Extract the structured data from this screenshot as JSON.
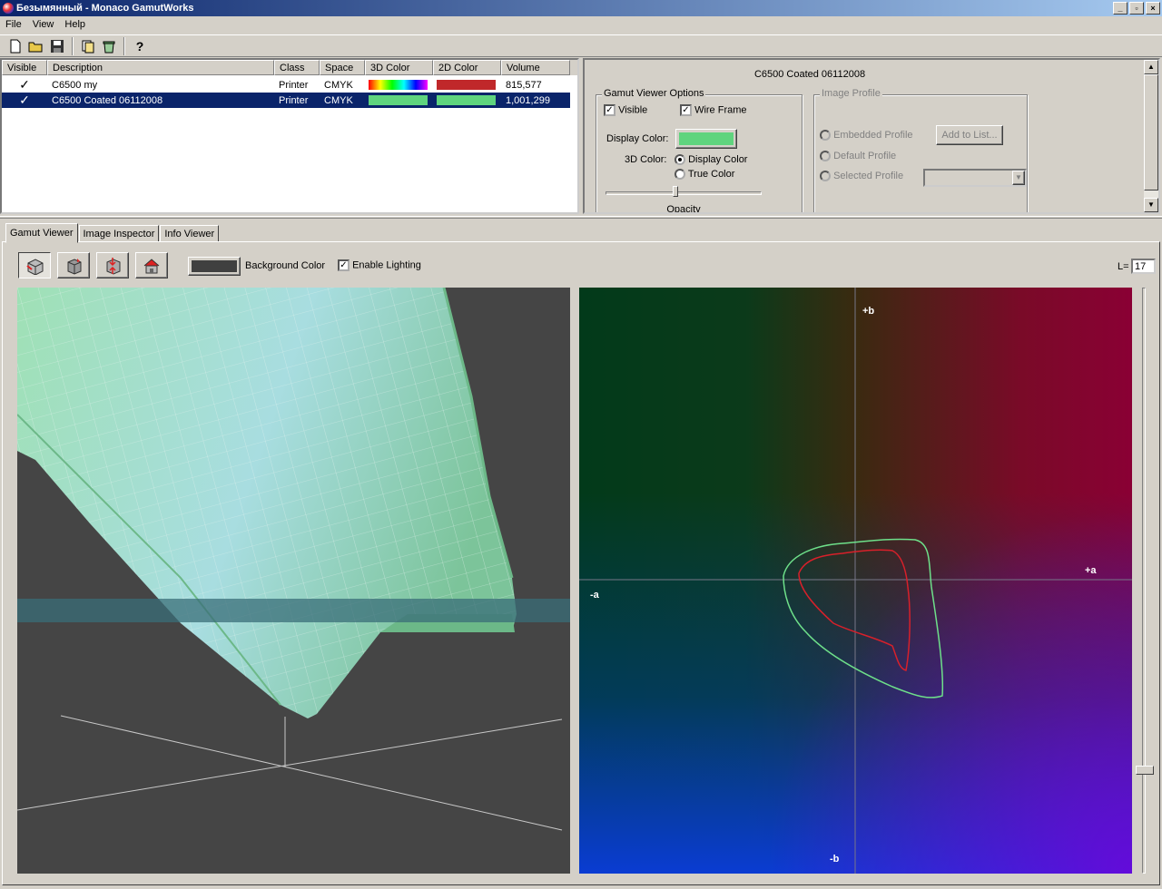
{
  "window": {
    "title": "Безымянный - Monaco GamutWorks"
  },
  "menu": [
    "File",
    "View",
    "Help"
  ],
  "toolbar_icons": [
    "new-icon",
    "open-icon",
    "save-icon",
    "copy-icon",
    "recycle-icon",
    "help-icon"
  ],
  "list": {
    "headers": [
      "Visible",
      "Description",
      "Class",
      "Space",
      "3D Color",
      "2D Color",
      "Volume"
    ],
    "rows": [
      {
        "visible": "✓",
        "description": "C6500 my",
        "class": "Printer",
        "space": "CMYK",
        "color3d": "spectrum",
        "color2d": "#c0282a",
        "volume": "815,577",
        "selected": false
      },
      {
        "visible": "✓",
        "description": "C6500 Coated 06112008",
        "class": "Printer",
        "space": "CMYK",
        "color3d": "#5fd47e",
        "color2d": "#5fd47e",
        "volume": "1,001,299",
        "selected": true
      }
    ]
  },
  "properties": {
    "header": "C6500 Coated 06112008",
    "gamut_group": "Gamut Viewer Options",
    "visible_label": "Visible",
    "wireframe_label": "Wire Frame",
    "display_color_label": "Display Color:",
    "display_color": "#5fd47e",
    "color3d_label": "3D Color:",
    "radio_display": "Display Color",
    "radio_true": "True Color",
    "opacity_label": "Opacity",
    "opacity_value": 0.45,
    "image_group": "Image Profile",
    "embedded": "Embedded Profile",
    "default": "Default Profile",
    "selected": "Selected Profile",
    "add_btn": "Add to List..."
  },
  "tabs": [
    "Gamut Viewer",
    "Image Inspector",
    "Info Viewer"
  ],
  "viewer": {
    "bg_color_label": "Background Color",
    "bg_color": "#404040",
    "lighting_label": "Enable Lighting",
    "l_label": "L=",
    "l_value": "17"
  },
  "plot2d": {
    "plus_b": "+b",
    "minus_b": "-b",
    "plus_a": "+a",
    "minus_a": "-a"
  }
}
